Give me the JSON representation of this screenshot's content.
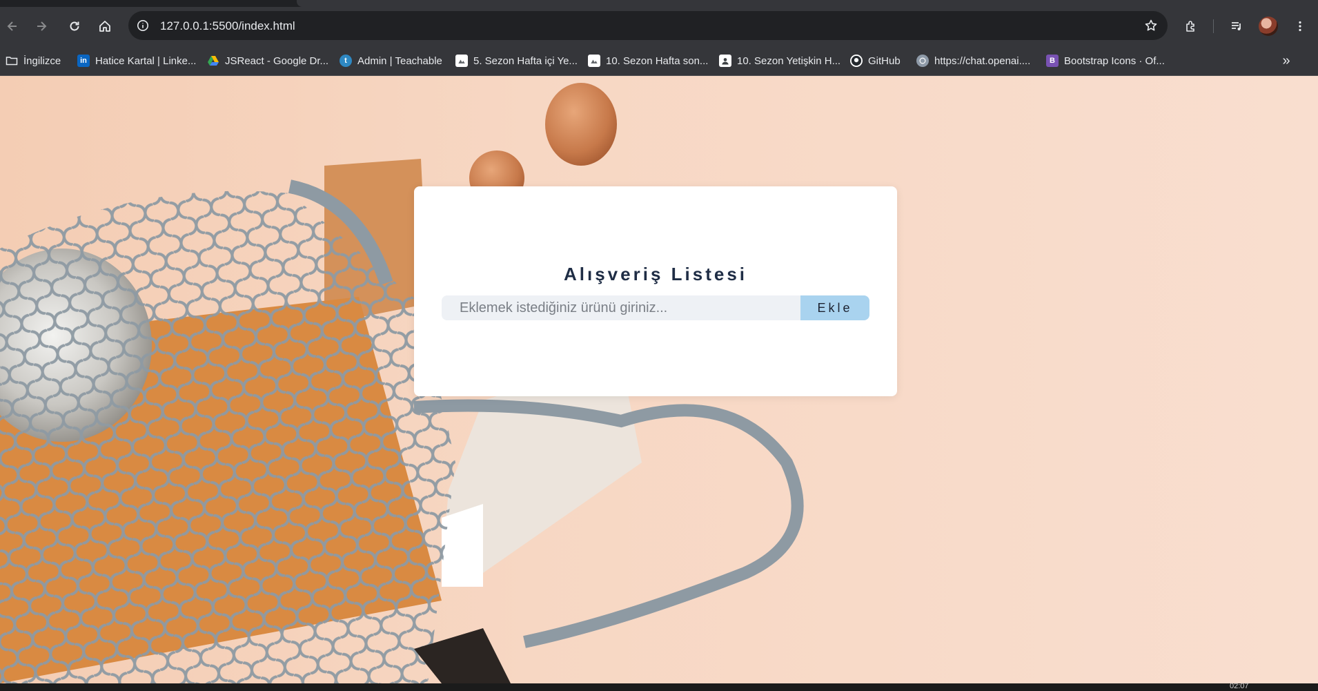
{
  "browser": {
    "url": "127.0.0.1:5500/index.html",
    "bookmarks": [
      {
        "label": "İngilizce",
        "icon": "folder-icon"
      },
      {
        "label": "Hatice Kartal | Linke...",
        "icon": "linkedin-icon"
      },
      {
        "label": "JSReact - Google Dr...",
        "icon": "google-drive-icon"
      },
      {
        "label": "Admin | Teachable",
        "icon": "teachable-icon"
      },
      {
        "label": "5. Sezon Hafta içi Ye...",
        "icon": "doc-icon"
      },
      {
        "label": "10. Sezon Hafta son...",
        "icon": "doc-icon"
      },
      {
        "label": "10. Sezon Yetişkin H...",
        "icon": "contact-icon"
      },
      {
        "label": "GitHub",
        "icon": "github-icon"
      },
      {
        "label": "https://chat.openai....",
        "icon": "openai-icon"
      },
      {
        "label": "Bootstrap Icons · Of...",
        "icon": "bootstrap-icon"
      }
    ],
    "more_label": "»"
  },
  "app": {
    "title": "Alışveriş Listesi",
    "input_placeholder": "Eklemek istediğiniz ürünü giriniz...",
    "add_button_label": "Ekle"
  },
  "taskbar": {
    "clock": "02:07"
  },
  "colors": {
    "page_background": "#f7d7c3",
    "card": "#ffffff",
    "title": "#1f2d45",
    "input_background": "#eef1f5",
    "button": "#a9d3ef"
  }
}
